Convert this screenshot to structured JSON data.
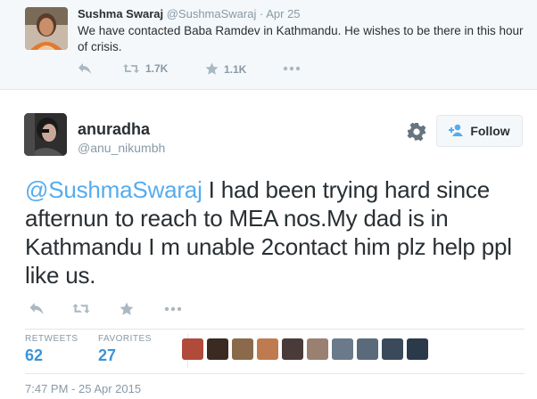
{
  "parent_tweet": {
    "name": "Sushma Swaraj",
    "handle": "@SushmaSwaraj",
    "separator": "·",
    "date": "Apr 25",
    "text": "We have contacted Baba Ramdev in Kathmandu. He wishes to be there in this hour of crisis.",
    "retweet_count": "1.7K",
    "favorite_count": "1.1K"
  },
  "main_tweet": {
    "name": "anuradha",
    "handle": "@anu_nikumbh",
    "follow_label": "Follow",
    "mention": "@SushmaSwaraj",
    "text": " I had been trying hard since afternun to reach to MEA nos.My dad is in Kathmandu I m unable 2contact him plz help ppl like us.",
    "stats": {
      "retweets_label": "RETWEETS",
      "retweets_value": "62",
      "favorites_label": "FAVORITES",
      "favorites_value": "27"
    },
    "timestamp": "7:47 PM - 25 Apr 2015"
  },
  "colors": {
    "link": "#55acee",
    "stat_blue": "#3b94d9",
    "muted": "#8899a6",
    "text": "#292f33"
  },
  "icons": {
    "reply": "reply-icon",
    "retweet": "retweet-icon",
    "favorite": "star-icon",
    "more": "more-icon",
    "settings": "gear-icon",
    "follow": "add-user-icon"
  }
}
